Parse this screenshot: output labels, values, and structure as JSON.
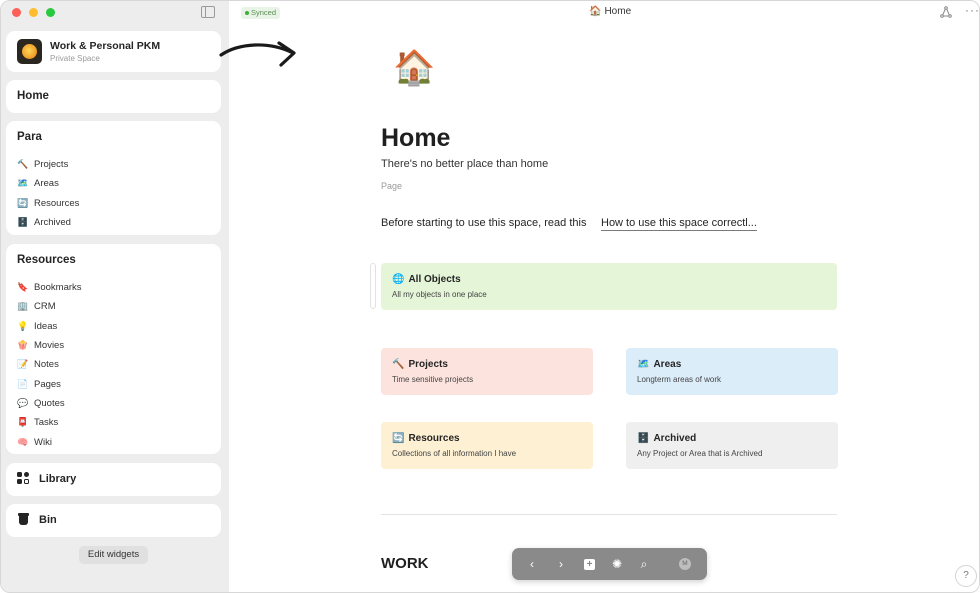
{
  "space": {
    "name": "Work & Personal PKM",
    "subtitle": "Private Space"
  },
  "sidebar": {
    "home_label": "Home",
    "para": {
      "title": "Para",
      "items": [
        {
          "icon": "🔨",
          "label": "Projects"
        },
        {
          "icon": "🗺️",
          "label": "Areas"
        },
        {
          "icon": "🔄",
          "label": "Resources"
        },
        {
          "icon": "🗄️",
          "label": "Archived"
        }
      ]
    },
    "resources": {
      "title": "Resources",
      "items": [
        {
          "icon": "🔖",
          "label": "Bookmarks"
        },
        {
          "icon": "🏢",
          "label": "CRM"
        },
        {
          "icon": "💡",
          "label": "Ideas"
        },
        {
          "icon": "🍿",
          "label": "Movies"
        },
        {
          "icon": "📝",
          "label": "Notes"
        },
        {
          "icon": "📄",
          "label": "Pages"
        },
        {
          "icon": "💬",
          "label": "Quotes"
        },
        {
          "icon": "📮",
          "label": "Tasks"
        },
        {
          "icon": "🧠",
          "label": "Wiki"
        }
      ]
    },
    "library_label": "Library",
    "bin_label": "Bin",
    "edit_widgets_label": "Edit widgets"
  },
  "header": {
    "sync_status": "Synced",
    "tab_icon": "🏠",
    "tab_title": "Home",
    "more": "···"
  },
  "page": {
    "icon": "🏠",
    "title": "Home",
    "description": "There's no better place than home",
    "type": "Page",
    "intro_text": "Before starting to use this space, read this",
    "intro_link": "How to use this space correctl..."
  },
  "widgets": {
    "all_objects": {
      "icon": "🌐",
      "title": "All Objects",
      "subtitle": "All my objects in one place"
    },
    "projects": {
      "icon": "🔨",
      "title": "Projects",
      "subtitle": "Time sensitive projects"
    },
    "areas": {
      "icon": "🗺️",
      "title": "Areas",
      "subtitle": "Longterm areas of work"
    },
    "resources": {
      "icon": "🔄",
      "title": "Resources",
      "subtitle": "Collections of all information I have"
    },
    "archived": {
      "icon": "🗄️",
      "title": "Archived",
      "subtitle": "Any Project or Area that is Archived"
    }
  },
  "work_heading": "WORK",
  "toolbar": {
    "back": "‹",
    "forward": "›",
    "plus": "+",
    "graph": "✺",
    "search": "⌕",
    "avatar": "M"
  },
  "help": "?"
}
